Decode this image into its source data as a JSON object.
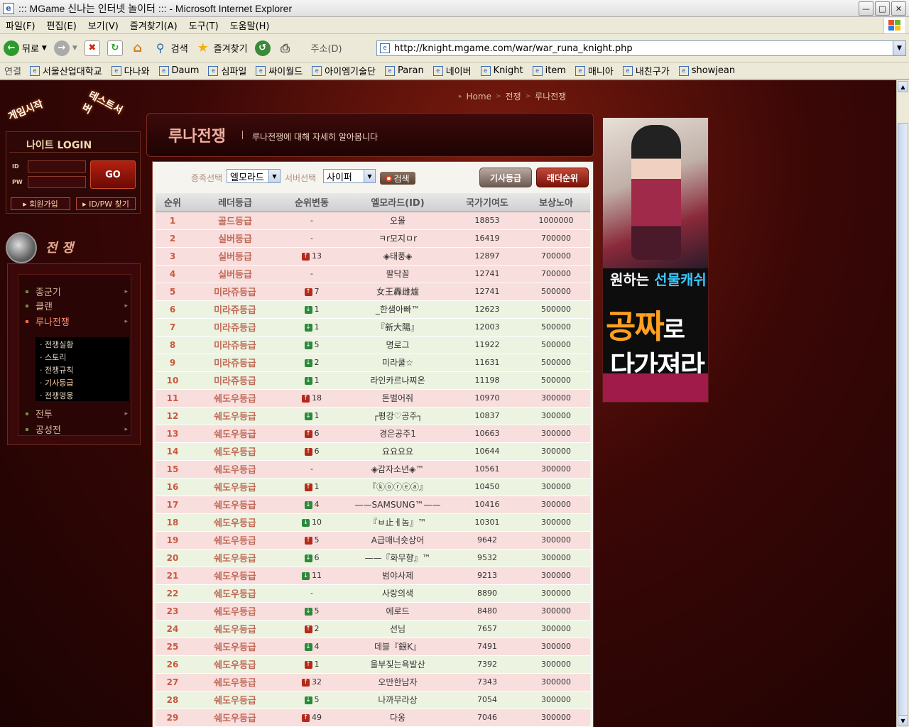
{
  "window": {
    "title": "::: MGame 신나는 인터넷 놀이터 ::: - Microsoft Internet Explorer"
  },
  "menu": [
    "파일(F)",
    "편집(E)",
    "보기(V)",
    "즐겨찾기(A)",
    "도구(T)",
    "도움말(H)"
  ],
  "toolbar": {
    "back": "뒤로",
    "search": "검색",
    "favorites": "즐겨찾기",
    "address_label": "주소(D)",
    "url": "http://knight.mgame.com/war/war_runa_knight.php"
  },
  "links": {
    "label": "연결",
    "items": [
      "서울산업대학교",
      "다나와",
      "Daum",
      "심파일",
      "싸이월드",
      "아이엠기술단",
      "Paran",
      "네이버",
      "Knight",
      "item",
      "매니아",
      "내친구가",
      "showjean"
    ]
  },
  "login": {
    "title": "나이트 LOGIN",
    "id_label": "ID",
    "pw_label": "PW",
    "go": "GO",
    "join": "회원가입",
    "find": "ID/PW 찾기"
  },
  "start": {
    "game_start": "게임시작",
    "test_server": "테스트서버"
  },
  "sidebar": {
    "title": "전 쟁",
    "items": [
      "종군기",
      "클랜",
      "루나전쟁",
      "전투",
      "공성전"
    ],
    "sub_items": [
      "전쟁실황",
      "스토리",
      "전쟁규칙",
      "기사등급",
      "전쟁영웅"
    ]
  },
  "breadcrumb": [
    "Home",
    "전쟁",
    "루나전쟁"
  ],
  "header": {
    "title": "루나전쟁",
    "desc": "루나전쟁에 대해 자세히 알아봅니다"
  },
  "filter": {
    "race_label": "종족선택",
    "race_value": "엘모라드",
    "server_label": "서버선택",
    "server_value": "사이퍼",
    "search_btn": "검색",
    "tab1": "기사등급",
    "tab2": "래더순위"
  },
  "table": {
    "headers": [
      "순위",
      "레더등급",
      "순위변동",
      "엘모라드(ID)",
      "국가기여도",
      "보상노아"
    ],
    "rows": [
      {
        "rank": "1",
        "grade": "골드등급",
        "dir": "",
        "change": "-",
        "id": "오몰",
        "contrib": "18853",
        "reward": "1000000"
      },
      {
        "rank": "2",
        "grade": "실버등급",
        "dir": "",
        "change": "-",
        "id": "ㅋr모지ㅁr",
        "contrib": "16419",
        "reward": "700000"
      },
      {
        "rank": "3",
        "grade": "실버등급",
        "dir": "up",
        "change": "13",
        "id": "◈태풍◈",
        "contrib": "12897",
        "reward": "700000"
      },
      {
        "rank": "4",
        "grade": "실버등급",
        "dir": "",
        "change": "-",
        "id": "팔닥꼴",
        "contrib": "12741",
        "reward": "700000"
      },
      {
        "rank": "5",
        "grade": "미라쥬등급",
        "dir": "up",
        "change": "7",
        "id": "女王轟雌爐",
        "contrib": "12741",
        "reward": "500000"
      },
      {
        "rank": "6",
        "grade": "미라쥬등급",
        "dir": "down",
        "change": "1",
        "id": "_한샘아빠™",
        "contrib": "12623",
        "reward": "500000"
      },
      {
        "rank": "7",
        "grade": "미라쥬등급",
        "dir": "down",
        "change": "1",
        "id": "『新大陽』",
        "contrib": "12003",
        "reward": "500000"
      },
      {
        "rank": "8",
        "grade": "미라쥬등급",
        "dir": "down",
        "change": "5",
        "id": "명로그",
        "contrib": "11922",
        "reward": "500000"
      },
      {
        "rank": "9",
        "grade": "미라쥬등급",
        "dir": "down",
        "change": "2",
        "id": "미라쿨☆",
        "contrib": "11631",
        "reward": "500000"
      },
      {
        "rank": "10",
        "grade": "미라쥬등급",
        "dir": "down",
        "change": "1",
        "id": "라인카르나찌온",
        "contrib": "11198",
        "reward": "500000"
      },
      {
        "rank": "11",
        "grade": "쉐도우등급",
        "dir": "up",
        "change": "18",
        "id": "돈벌어줘",
        "contrib": "10970",
        "reward": "300000"
      },
      {
        "rank": "12",
        "grade": "쉐도우등급",
        "dir": "down",
        "change": "1",
        "id": "┌평강♡공주┐",
        "contrib": "10837",
        "reward": "300000"
      },
      {
        "rank": "13",
        "grade": "쉐도우등급",
        "dir": "up",
        "change": "6",
        "id": "경은공주1",
        "contrib": "10663",
        "reward": "300000"
      },
      {
        "rank": "14",
        "grade": "쉐도우등급",
        "dir": "up",
        "change": "6",
        "id": "요요요요",
        "contrib": "10644",
        "reward": "300000"
      },
      {
        "rank": "15",
        "grade": "쉐도우등급",
        "dir": "",
        "change": "-",
        "id": "◈감자소년◈™",
        "contrib": "10561",
        "reward": "300000"
      },
      {
        "rank": "16",
        "grade": "쉐도우등급",
        "dir": "up",
        "change": "1",
        "id": "『ⓚⓞⓡⓔⓐ』",
        "contrib": "10450",
        "reward": "300000"
      },
      {
        "rank": "17",
        "grade": "쉐도우등급",
        "dir": "down",
        "change": "4",
        "id": "——SAMSUNG™——",
        "contrib": "10416",
        "reward": "300000"
      },
      {
        "rank": "18",
        "grade": "쉐도우등급",
        "dir": "down",
        "change": "10",
        "id": "『ㅂ止ㅔ놈』™",
        "contrib": "10301",
        "reward": "300000"
      },
      {
        "rank": "19",
        "grade": "쉐도우등급",
        "dir": "up",
        "change": "5",
        "id": "A급매너숏상어",
        "contrib": "9642",
        "reward": "300000"
      },
      {
        "rank": "20",
        "grade": "쉐도우등급",
        "dir": "down",
        "change": "6",
        "id": "——『화무향』™",
        "contrib": "9532",
        "reward": "300000"
      },
      {
        "rank": "21",
        "grade": "쉐도우등급",
        "dir": "down",
        "change": "11",
        "id": "범야사제",
        "contrib": "9213",
        "reward": "300000"
      },
      {
        "rank": "22",
        "grade": "쉐도우등급",
        "dir": "",
        "change": "-",
        "id": "사랑의색",
        "contrib": "8890",
        "reward": "300000"
      },
      {
        "rank": "23",
        "grade": "쉐도우등급",
        "dir": "down",
        "change": "5",
        "id": "에로드",
        "contrib": "8480",
        "reward": "300000"
      },
      {
        "rank": "24",
        "grade": "쉐도우등급",
        "dir": "up",
        "change": "2",
        "id": "선님",
        "contrib": "7657",
        "reward": "300000"
      },
      {
        "rank": "25",
        "grade": "쉐도우등급",
        "dir": "down",
        "change": "4",
        "id": "데블『銀K』",
        "contrib": "7491",
        "reward": "300000"
      },
      {
        "rank": "26",
        "grade": "쉐도우등급",
        "dir": "up",
        "change": "1",
        "id": "울부짖는욕발산",
        "contrib": "7392",
        "reward": "300000"
      },
      {
        "rank": "27",
        "grade": "쉐도우등급",
        "dir": "up",
        "change": "32",
        "id": "오만한남자",
        "contrib": "7343",
        "reward": "300000"
      },
      {
        "rank": "28",
        "grade": "쉐도우등급",
        "dir": "down",
        "change": "5",
        "id": "나까무라상",
        "contrib": "7054",
        "reward": "300000"
      },
      {
        "rank": "29",
        "grade": "쉐도우등급",
        "dir": "up",
        "change": "49",
        "id": "다옹",
        "contrib": "7046",
        "reward": "300000"
      }
    ]
  },
  "ad": {
    "line1a": "원하는",
    "line1b": "선물캐쉬",
    "line2a": "공짜",
    "line2b": "로",
    "line3": "다가져라"
  },
  "colors": {
    "accent_red": "#b42a18",
    "down_green": "#2a8a3a",
    "pink_row": "#f8dedd",
    "green_row": "#ecf3e0"
  }
}
